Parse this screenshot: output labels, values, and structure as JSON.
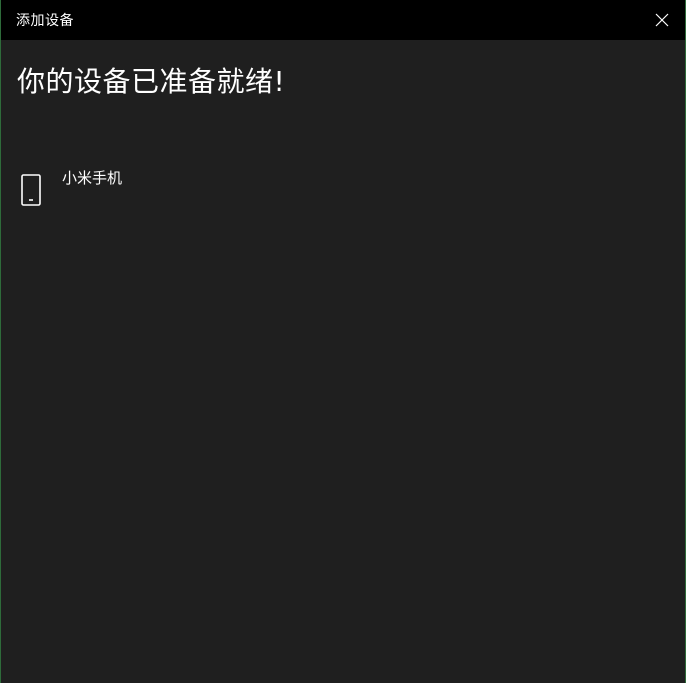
{
  "window": {
    "title": "添加设备",
    "close_icon": "close-icon"
  },
  "main": {
    "heading": "你的设备已准备就绪!",
    "devices": [
      {
        "name": "小米手机",
        "icon": "phone-icon"
      }
    ]
  },
  "colors": {
    "titlebar_bg": "#000000",
    "content_bg": "#1f1f1f",
    "text": "#ffffff",
    "window_border": "#2e6b3a"
  }
}
